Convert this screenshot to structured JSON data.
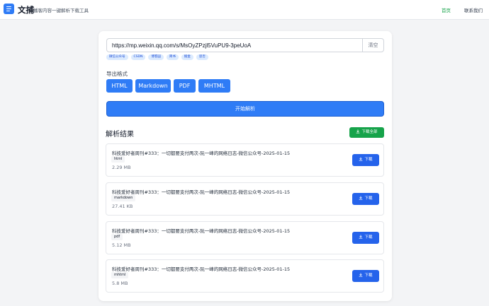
{
  "header": {
    "brand": "文捕",
    "tagline": "播客内容一键解析下载工具",
    "nav": {
      "home": "首页",
      "contact": "联系我们"
    }
  },
  "form": {
    "url_value": "https://mp.weixin.qq.com/s/MsOyZPzjl5VuPU9-3peUoA",
    "clear_label": "清空",
    "tags": [
      "微信公众号",
      "CSDN",
      "博客园",
      "简书",
      "掘金",
      "思否"
    ],
    "format_label": "导出格式",
    "formats": [
      "HTML",
      "Markdown",
      "PDF",
      "MHTML"
    ],
    "start_label": "开始解析"
  },
  "results": {
    "title": "解析结果",
    "download_all_label": "下载全部",
    "download_label": "下载",
    "items": [
      {
        "title": "科技爱好者周刊#333：一切都要支付两次-阮一峰的网络日志-微信公众号-2025-01-15",
        "type": "html",
        "size": "2.29 MB"
      },
      {
        "title": "科技爱好者周刊#333：一切都要支付两次-阮一峰的网络日志-微信公众号-2025-01-15",
        "type": "markdown",
        "size": "27.41 KB"
      },
      {
        "title": "科技爱好者周刊#333：一切都要支付两次-阮一峰的网络日志-微信公众号-2025-01-15",
        "type": "pdf",
        "size": "5.12 MB"
      },
      {
        "title": "科技爱好者周刊#333：一切都要支付两次-阮一峰的网络日志-微信公众号-2025-01-15",
        "type": "mhtml",
        "size": "5.8 MB"
      }
    ]
  },
  "colors": {
    "primary": "#2f7cf6",
    "success": "#16a34a",
    "tag_bg": "#dbeafe",
    "page_bg": "#f3f4f6"
  },
  "icons": {
    "logo": "menu-icon",
    "download": "download-icon"
  }
}
